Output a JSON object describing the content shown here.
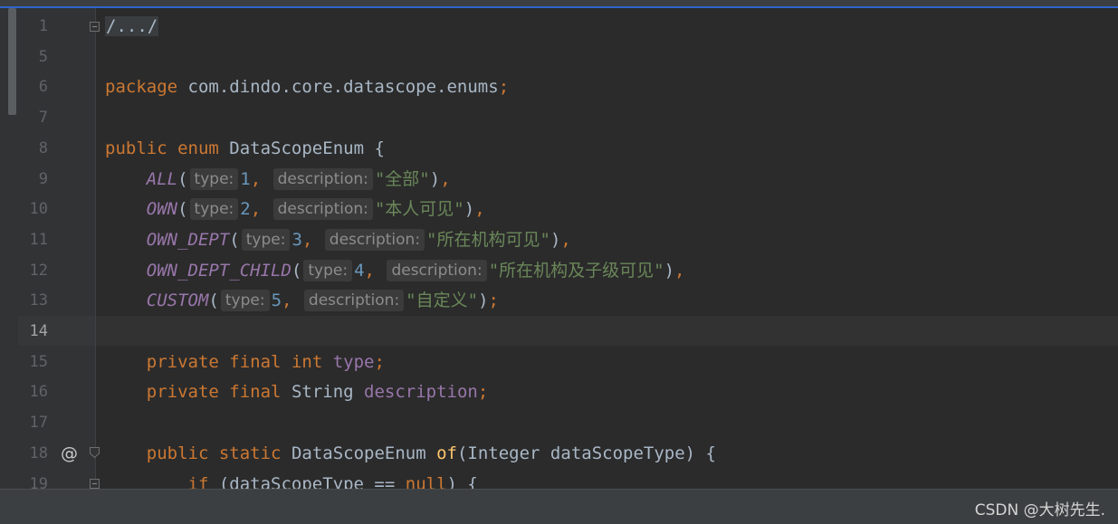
{
  "editor": {
    "lines": [
      {
        "num": "1",
        "segments": [
          {
            "t": "/.../",
            "c": "collapsed"
          }
        ]
      },
      {
        "num": "5",
        "segments": []
      },
      {
        "num": "6",
        "segments": [
          {
            "t": "package",
            "c": "kw"
          },
          {
            "t": " com.dindo.core.datascope.enums"
          },
          {
            "t": ";",
            "c": "kw"
          }
        ]
      },
      {
        "num": "7",
        "segments": []
      },
      {
        "num": "8",
        "segments": [
          {
            "t": "public",
            "c": "kw"
          },
          {
            "t": " "
          },
          {
            "t": "enum",
            "c": "kw"
          },
          {
            "t": " DataScopeEnum {"
          }
        ]
      },
      {
        "num": "9",
        "segments": [
          {
            "t": "    "
          },
          {
            "t": "ALL",
            "c": "enum-c"
          },
          {
            "t": "("
          },
          {
            "t": "type:",
            "c": "hint"
          },
          {
            "t": "1",
            "c": "num"
          },
          {
            "t": ", ",
            "c": "kw"
          },
          {
            "t": "description:",
            "c": "hint"
          },
          {
            "t": "\"全部\"",
            "c": "str"
          },
          {
            "t": ")"
          },
          {
            "t": ",",
            "c": "kw"
          }
        ]
      },
      {
        "num": "10",
        "segments": [
          {
            "t": "    "
          },
          {
            "t": "OWN",
            "c": "enum-c"
          },
          {
            "t": "("
          },
          {
            "t": "type:",
            "c": "hint"
          },
          {
            "t": "2",
            "c": "num"
          },
          {
            "t": ", ",
            "c": "kw"
          },
          {
            "t": "description:",
            "c": "hint"
          },
          {
            "t": "\"本人可见\"",
            "c": "str"
          },
          {
            "t": ")"
          },
          {
            "t": ",",
            "c": "kw"
          }
        ]
      },
      {
        "num": "11",
        "segments": [
          {
            "t": "    "
          },
          {
            "t": "OWN_DEPT",
            "c": "enum-c"
          },
          {
            "t": "("
          },
          {
            "t": "type:",
            "c": "hint"
          },
          {
            "t": "3",
            "c": "num"
          },
          {
            "t": ", ",
            "c": "kw"
          },
          {
            "t": "description:",
            "c": "hint"
          },
          {
            "t": "\"所在机构可见\"",
            "c": "str"
          },
          {
            "t": ")"
          },
          {
            "t": ",",
            "c": "kw"
          }
        ]
      },
      {
        "num": "12",
        "segments": [
          {
            "t": "    "
          },
          {
            "t": "OWN_DEPT_CHILD",
            "c": "enum-c"
          },
          {
            "t": "("
          },
          {
            "t": "type:",
            "c": "hint"
          },
          {
            "t": "4",
            "c": "num"
          },
          {
            "t": ", ",
            "c": "kw"
          },
          {
            "t": "description:",
            "c": "hint"
          },
          {
            "t": "\"所在机构及子级可见\"",
            "c": "str"
          },
          {
            "t": ")"
          },
          {
            "t": ",",
            "c": "kw"
          }
        ]
      },
      {
        "num": "13",
        "segments": [
          {
            "t": "    "
          },
          {
            "t": "CUSTOM",
            "c": "enum-c"
          },
          {
            "t": "("
          },
          {
            "t": "type:",
            "c": "hint"
          },
          {
            "t": "5",
            "c": "num"
          },
          {
            "t": ", ",
            "c": "kw"
          },
          {
            "t": "description:",
            "c": "hint"
          },
          {
            "t": "\"自定义\"",
            "c": "str"
          },
          {
            "t": ")"
          },
          {
            "t": ";",
            "c": "kw"
          }
        ]
      },
      {
        "num": "14",
        "segments": [],
        "current": true
      },
      {
        "num": "15",
        "segments": [
          {
            "t": "    "
          },
          {
            "t": "private",
            "c": "kw"
          },
          {
            "t": " "
          },
          {
            "t": "final",
            "c": "kw"
          },
          {
            "t": " "
          },
          {
            "t": "int",
            "c": "kw"
          },
          {
            "t": " "
          },
          {
            "t": "type",
            "c": "field"
          },
          {
            "t": ";",
            "c": "kw"
          }
        ]
      },
      {
        "num": "16",
        "segments": [
          {
            "t": "    "
          },
          {
            "t": "private",
            "c": "kw"
          },
          {
            "t": " "
          },
          {
            "t": "final",
            "c": "kw"
          },
          {
            "t": " String "
          },
          {
            "t": "description",
            "c": "field"
          },
          {
            "t": ";",
            "c": "kw"
          }
        ]
      },
      {
        "num": "17",
        "segments": []
      },
      {
        "num": "18",
        "segments": [
          {
            "t": "    "
          },
          {
            "t": "public",
            "c": "kw"
          },
          {
            "t": " "
          },
          {
            "t": "static",
            "c": "kw"
          },
          {
            "t": " DataScopeEnum "
          },
          {
            "t": "of",
            "c": "fn"
          },
          {
            "t": "(Integer dataScopeType) {"
          }
        ],
        "at": true
      },
      {
        "num": "19",
        "segments": [
          {
            "t": "        "
          },
          {
            "t": "if",
            "c": "kw"
          },
          {
            "t": " (dataScopeType == "
          },
          {
            "t": "null",
            "c": "kw"
          },
          {
            "t": ") {"
          }
        ]
      }
    ]
  },
  "gutter_icons": {
    "at_symbol": "@"
  },
  "watermark": "CSDN @大树先生.",
  "colors": {
    "background": "#2b2b2b",
    "keyword": "#cc7832",
    "enum_constant": "#9876aa",
    "number": "#6897bb",
    "string": "#6a8759",
    "method": "#ffc66d",
    "text": "#a9b7c6"
  }
}
